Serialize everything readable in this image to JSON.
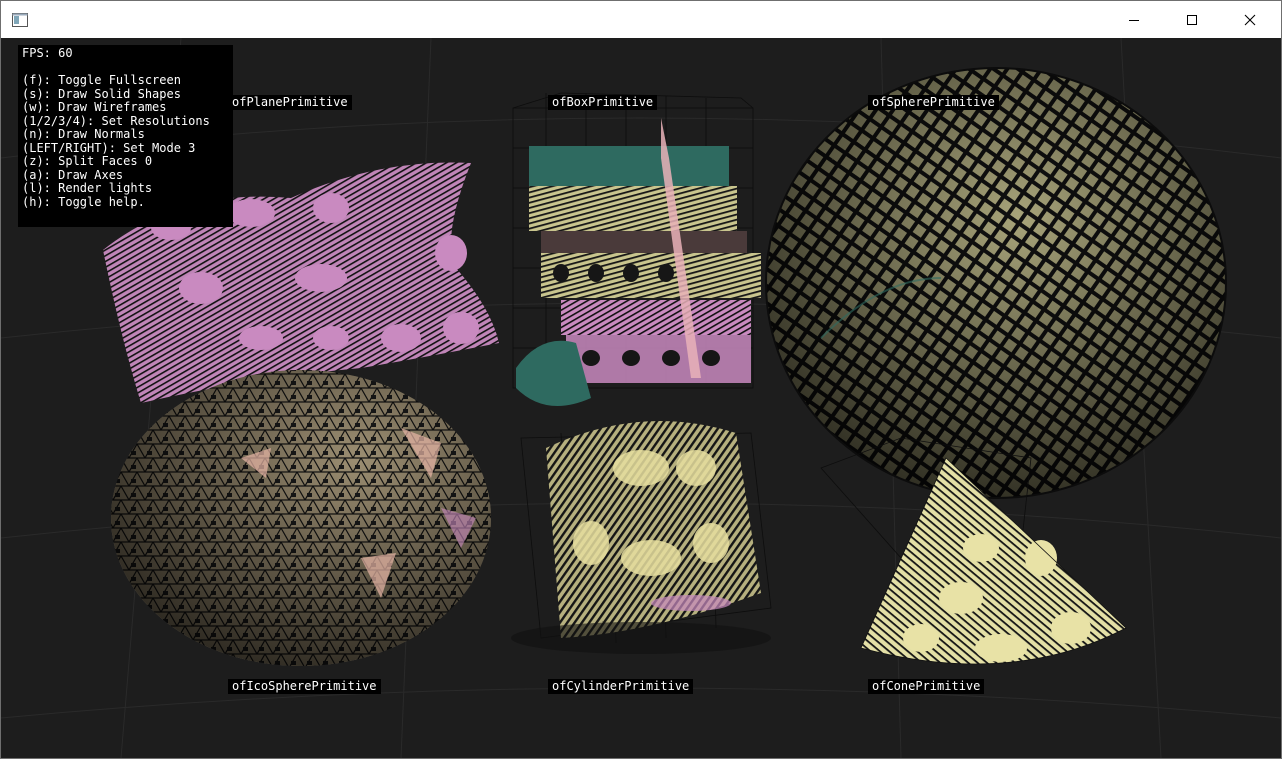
{
  "window": {
    "icon": "app-window-icon",
    "controls": [
      "minimize-icon",
      "maximize-icon",
      "close-icon"
    ]
  },
  "help": {
    "fps": "FPS: 60",
    "lines": [
      "(f): Toggle Fullscreen",
      "(s): Draw Solid Shapes",
      "(w): Draw Wireframes",
      "(1/2/3/4): Set Resolutions",
      "(n): Draw Normals",
      "(LEFT/RIGHT): Set Mode 3",
      "(z): Split Faces 0",
      "(a): Draw Axes",
      "(l): Render lights",
      "(h): Toggle help."
    ]
  },
  "labels": {
    "plane": "ofPlanePrimitive",
    "box": "ofBoxPrimitive",
    "sphere": "ofSpherePrimitive",
    "icosphere": "ofIcoSpherePrimitive",
    "cylinder": "ofCylinderPrimitive",
    "cone": "ofConePrimitive"
  },
  "colors": {
    "background": "#1d1d1d",
    "plane": "#c98ac0",
    "box_teal": "#2e6a60",
    "box_yellow": "#c9c58e",
    "box_pink": "#c98ac0",
    "box_dark": "#4a3a3a",
    "sphere": "#a8a47a",
    "icosphere": "#9c8e72",
    "cylinder": "#b6b07e",
    "cone": "#e4e0a6"
  }
}
